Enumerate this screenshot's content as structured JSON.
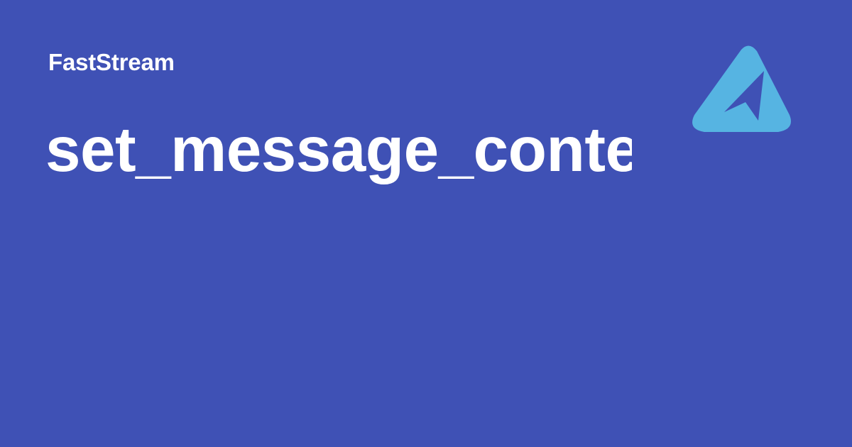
{
  "site": {
    "name": "FastStream"
  },
  "page": {
    "title": "set_message_context"
  },
  "logo": {
    "icon": "faststream-logo-icon",
    "color": "#56b4e2",
    "background": "#3f51b5"
  }
}
